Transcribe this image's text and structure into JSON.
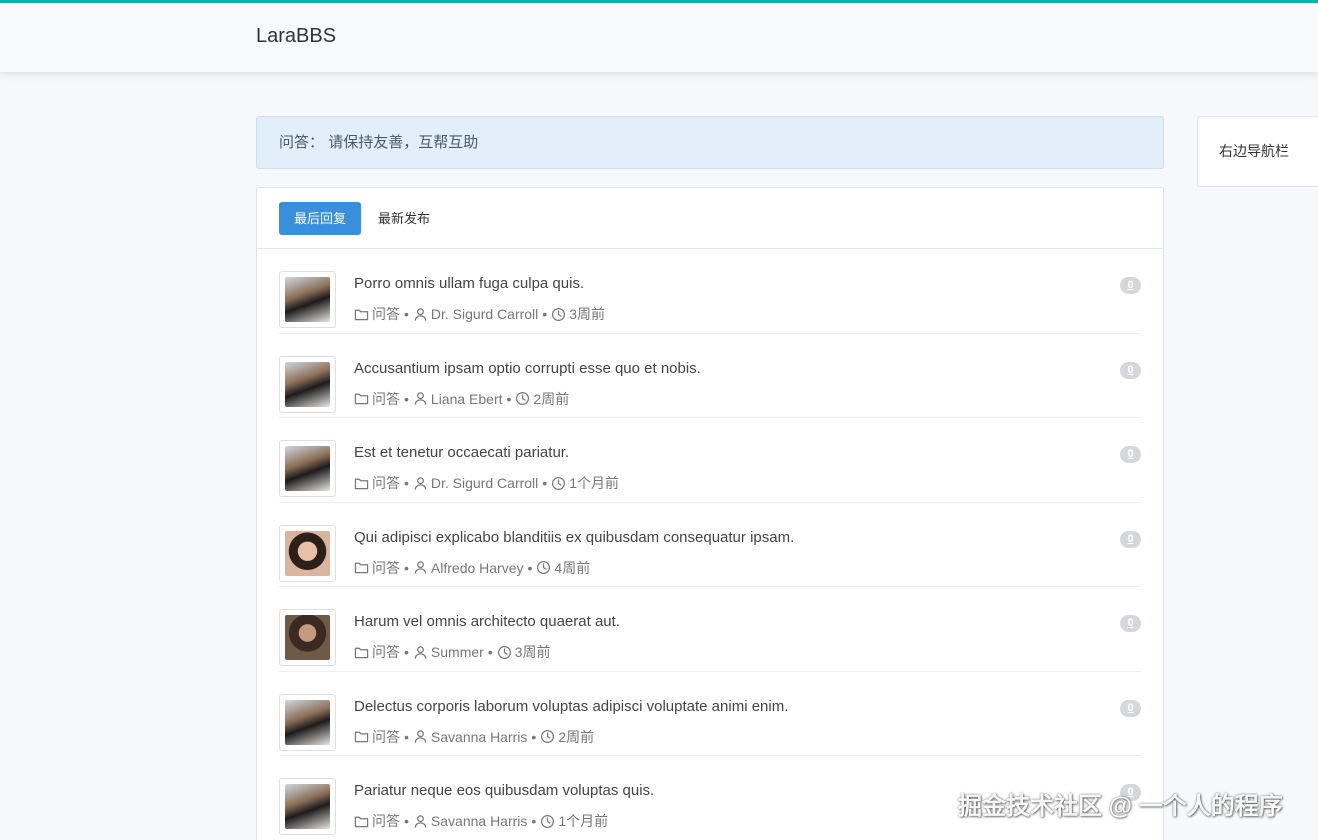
{
  "navbar": {
    "brand": "LaraBBS"
  },
  "notice": {
    "category": "问答：",
    "description": "请保持友善，互帮互助"
  },
  "tabs": [
    {
      "label": "最后回复",
      "active": true
    },
    {
      "label": "最新发布",
      "active": false
    }
  ],
  "topics": [
    {
      "title": "Porro omnis ullam fuga culpa quis.",
      "category": "问答",
      "author": "Dr. Sigurd Carroll",
      "time": "3周前",
      "replies": "0",
      "avatar": "p1"
    },
    {
      "title": "Accusantium ipsam optio corrupti esse quo et nobis.",
      "category": "问答",
      "author": "Liana Ebert",
      "time": "2周前",
      "replies": "0",
      "avatar": "p1"
    },
    {
      "title": "Est et tenetur occaecati pariatur.",
      "category": "问答",
      "author": "Dr. Sigurd Carroll",
      "time": "1个月前",
      "replies": "0",
      "avatar": "p1"
    },
    {
      "title": "Qui adipisci explicabo blanditiis ex quibusdam consequatur ipsam.",
      "category": "问答",
      "author": "Alfredo Harvey",
      "time": "4周前",
      "replies": "0",
      "avatar": "p2"
    },
    {
      "title": "Harum vel omnis architecto quaerat aut.",
      "category": "问答",
      "author": "Summer",
      "time": "3周前",
      "replies": "0",
      "avatar": "p3"
    },
    {
      "title": "Delectus corporis laborum voluptas adipisci voluptate animi enim.",
      "category": "问答",
      "author": "Savanna Harris",
      "time": "2周前",
      "replies": "0",
      "avatar": "p1"
    },
    {
      "title": "Pariatur neque eos quibusdam voluptas quis.",
      "category": "问答",
      "author": "Savanna Harris",
      "time": "1个月前",
      "replies": "0",
      "avatar": "p1"
    }
  ],
  "sidebar": {
    "label": "右边导航栏"
  },
  "watermark": "掘金技术社区 @ 一个人的程序",
  "colors": {
    "accent": "#00b5ad",
    "primary": "#3a8fdd",
    "notice_bg": "#e2eefa"
  },
  "icons": {
    "category": "folder-icon",
    "author": "user-icon",
    "time": "clock-icon"
  }
}
